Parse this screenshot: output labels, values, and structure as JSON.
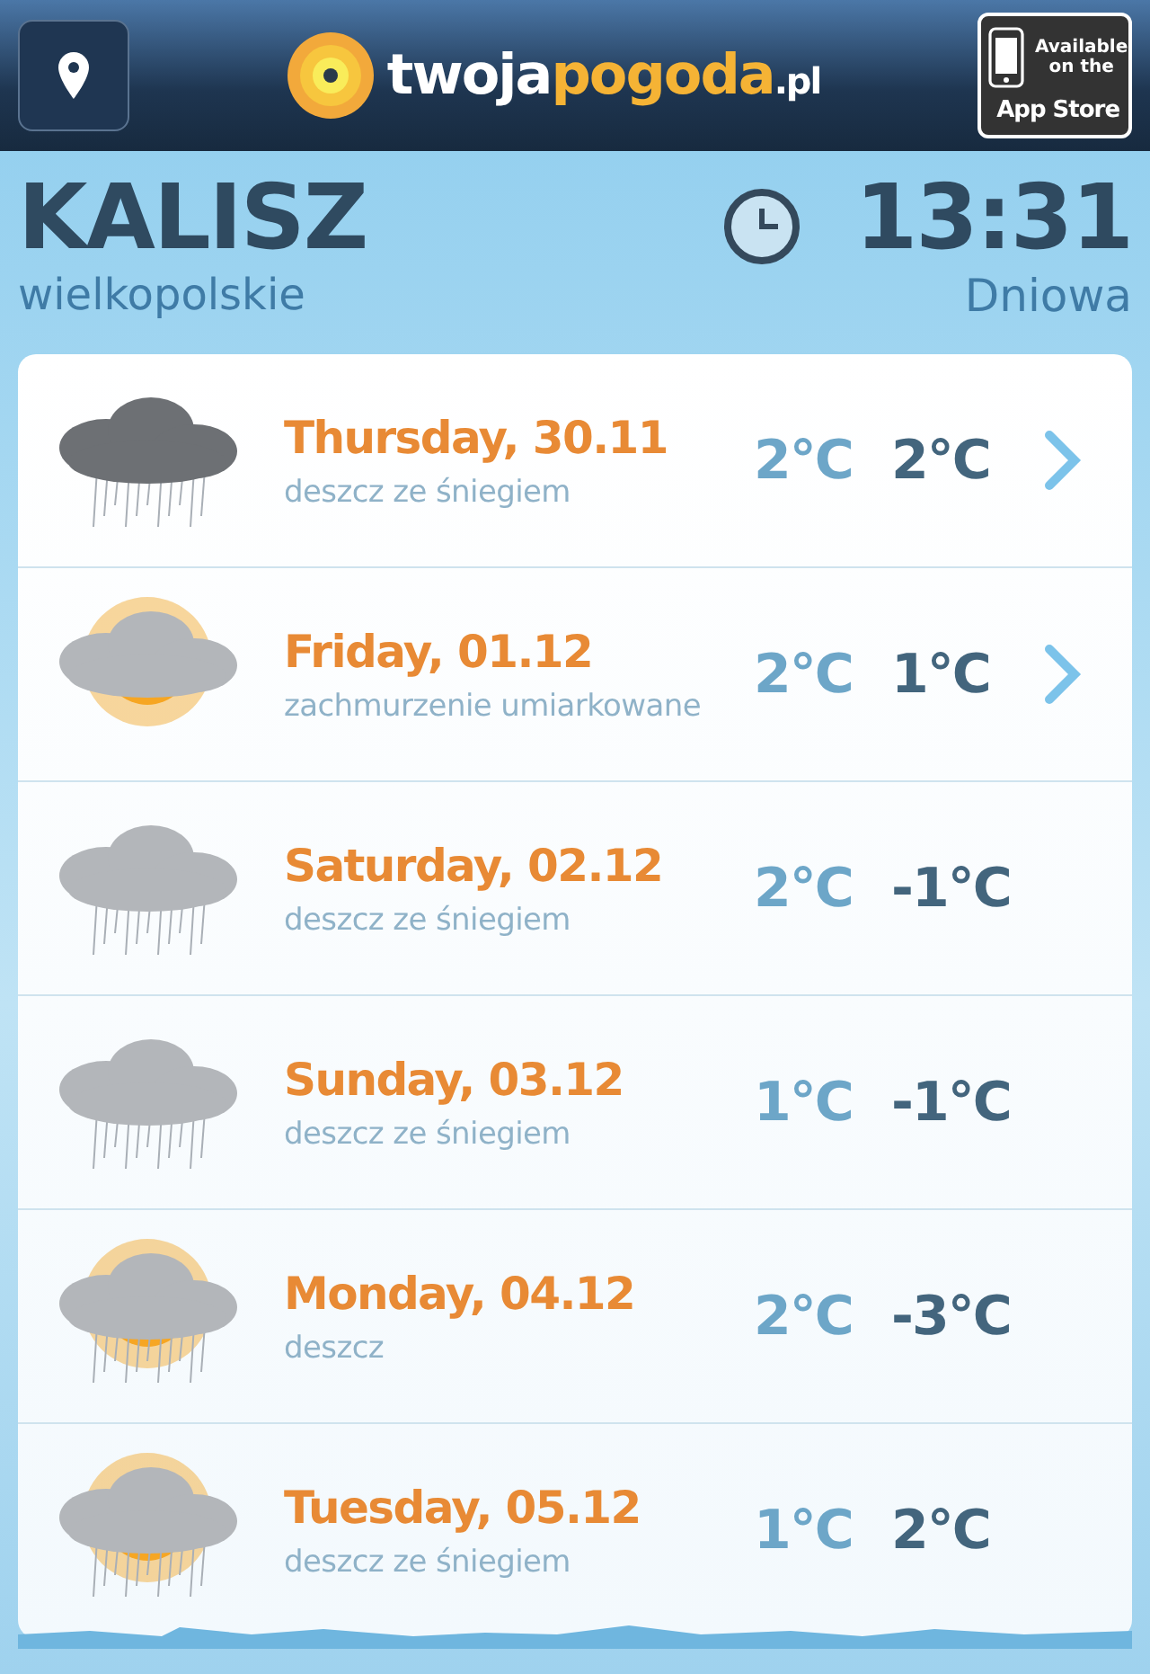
{
  "header": {
    "logo": [
      {
        "text": "twoja",
        "kind": "light"
      },
      {
        "text": "pogoda",
        "kind": "accent"
      },
      {
        "text": ".pl",
        "kind": "small"
      }
    ],
    "store_badge": {
      "line1": "Available",
      "line2": "on the",
      "line3": "App Store"
    }
  },
  "location": {
    "city": "KALISZ",
    "region": "wielkopolskie",
    "time": "13:31",
    "period": "Dniowa"
  },
  "days": [
    {
      "date": "Thursday, 30.11",
      "description": "deszcz ze śniegiem",
      "temp_high": "2°C",
      "temp_low": "2°C",
      "kind": "rain_dark",
      "has_detail": true
    },
    {
      "date": "Friday, 01.12",
      "description": "zachmurzenie umiarkowane",
      "temp_high": "2°C",
      "temp_low": "1°C",
      "kind": "sun_cloud",
      "has_detail": true
    },
    {
      "date": "Saturday, 02.12",
      "description": "deszcz ze śniegiem",
      "temp_high": "2°C",
      "temp_low": "-1°C",
      "kind": "rain",
      "has_detail": false
    },
    {
      "date": "Sunday, 03.12",
      "description": "deszcz ze śniegiem",
      "temp_high": "1°C",
      "temp_low": "-1°C",
      "kind": "rain",
      "has_detail": false
    },
    {
      "date": "Monday, 04.12",
      "description": "deszcz",
      "temp_high": "2°C",
      "temp_low": "-3°C",
      "kind": "sun_cloud_rain",
      "has_detail": false
    },
    {
      "date": "Tuesday, 05.12",
      "description": "deszcz ze śniegiem",
      "temp_high": "1°C",
      "temp_low": "2°C",
      "kind": "sun_cloud_rain",
      "has_detail": false
    }
  ]
}
